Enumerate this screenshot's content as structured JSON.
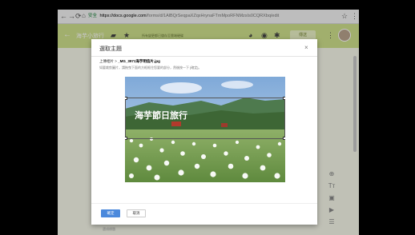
{
  "browser": {
    "secure_label": "安全",
    "url_host": "https://docs.google.com",
    "url_path": "/forms/d/1AlBQrSeqpaXZqxHrynaFTmMpoRFNMzsIs0CQRXbq/edit"
  },
  "forms_header": {
    "title": "海芋小旅行",
    "saved_text": "所有變更都已儲存至雲端硬碟",
    "send_label": "傳送"
  },
  "dialog": {
    "title": "選取主題",
    "upload_prefix": "上傳相片 >",
    "upload_filename": "_MG_3971海芋明信片.jpg",
    "hint": "如要裁剪圖片，請拖曳下面的方框框住您要的部分，然後按一下 [確定]。",
    "confirm_label": "確定",
    "cancel_label": "取消",
    "image_caption": "海芋節日旅行"
  },
  "background": {
    "bottom_text": "選項標題"
  },
  "icons": {
    "back": "arrow-back-icon",
    "forward": "arrow-forward-icon",
    "reload": "reload-icon",
    "home": "home-icon",
    "folder": "folder-icon",
    "star": "star-icon",
    "palette": "palette-icon",
    "preview": "eye-icon",
    "settings": "gear-icon",
    "more": "more-vert-icon",
    "close": "close-icon"
  },
  "colors": {
    "header_bg": "#cfe08c",
    "confirm_bg": "#4b89dc"
  }
}
